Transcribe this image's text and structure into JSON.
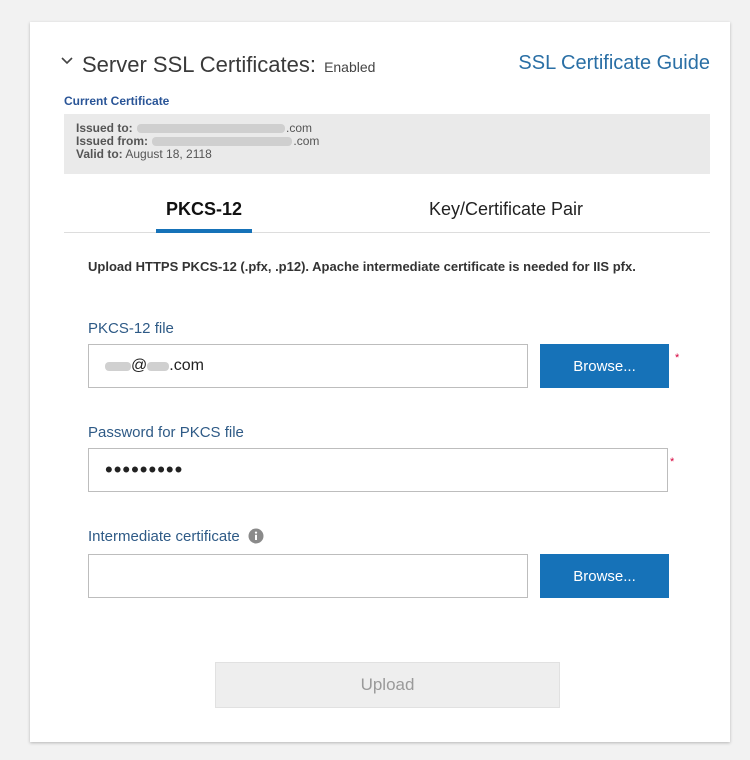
{
  "header": {
    "title": "Server SSL Certificates:",
    "status": "Enabled",
    "guide_link": "SSL Certificate Guide"
  },
  "current_certificate": {
    "label": "Current Certificate",
    "issued_to_label": "Issued to:",
    "issued_to_suffix": ".com",
    "issued_from_label": "Issued from:",
    "issued_from_suffix": ".com",
    "valid_to_label": "Valid to:",
    "valid_to_value": "August 18, 2118"
  },
  "tabs": [
    {
      "label": "PKCS-12",
      "active": true
    },
    {
      "label": "Key/Certificate Pair",
      "active": false
    }
  ],
  "form": {
    "intro": "Upload HTTPS PKCS-12 (.pfx, .p12). Apache intermediate certificate is needed for IIS pfx.",
    "pkcs_file": {
      "label": "PKCS-12 file",
      "value_at": "@",
      "value_suffix": ".com",
      "browse_label": "Browse..."
    },
    "password": {
      "label": "Password for PKCS file",
      "value_masked": "•••••••••"
    },
    "intermediate": {
      "label": "Intermediate certificate",
      "value": "",
      "browse_label": "Browse..."
    },
    "required_mark": "*",
    "upload_label": "Upload"
  },
  "colors": {
    "accent": "#1672b8",
    "link": "#2a6fa5",
    "label": "#2e5a86",
    "required": "#d6003b"
  },
  "icons": [
    "chevron-down-icon",
    "info-icon"
  ]
}
